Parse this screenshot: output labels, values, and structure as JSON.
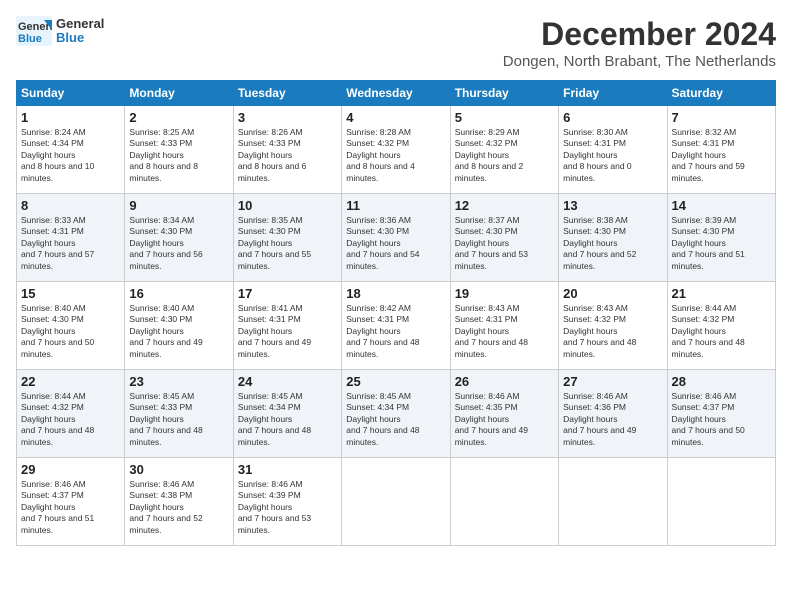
{
  "logo": {
    "line1": "General",
    "line2": "Blue"
  },
  "title": "December 2024",
  "location": "Dongen, North Brabant, The Netherlands",
  "weekdays": [
    "Sunday",
    "Monday",
    "Tuesday",
    "Wednesday",
    "Thursday",
    "Friday",
    "Saturday"
  ],
  "weeks": [
    [
      {
        "day": "1",
        "sunrise": "8:24 AM",
        "sunset": "4:34 PM",
        "daylight": "8 hours and 10 minutes."
      },
      {
        "day": "2",
        "sunrise": "8:25 AM",
        "sunset": "4:33 PM",
        "daylight": "8 hours and 8 minutes."
      },
      {
        "day": "3",
        "sunrise": "8:26 AM",
        "sunset": "4:33 PM",
        "daylight": "8 hours and 6 minutes."
      },
      {
        "day": "4",
        "sunrise": "8:28 AM",
        "sunset": "4:32 PM",
        "daylight": "8 hours and 4 minutes."
      },
      {
        "day": "5",
        "sunrise": "8:29 AM",
        "sunset": "4:32 PM",
        "daylight": "8 hours and 2 minutes."
      },
      {
        "day": "6",
        "sunrise": "8:30 AM",
        "sunset": "4:31 PM",
        "daylight": "8 hours and 0 minutes."
      },
      {
        "day": "7",
        "sunrise": "8:32 AM",
        "sunset": "4:31 PM",
        "daylight": "7 hours and 59 minutes."
      }
    ],
    [
      {
        "day": "8",
        "sunrise": "8:33 AM",
        "sunset": "4:31 PM",
        "daylight": "7 hours and 57 minutes."
      },
      {
        "day": "9",
        "sunrise": "8:34 AM",
        "sunset": "4:30 PM",
        "daylight": "7 hours and 56 minutes."
      },
      {
        "day": "10",
        "sunrise": "8:35 AM",
        "sunset": "4:30 PM",
        "daylight": "7 hours and 55 minutes."
      },
      {
        "day": "11",
        "sunrise": "8:36 AM",
        "sunset": "4:30 PM",
        "daylight": "7 hours and 54 minutes."
      },
      {
        "day": "12",
        "sunrise": "8:37 AM",
        "sunset": "4:30 PM",
        "daylight": "7 hours and 53 minutes."
      },
      {
        "day": "13",
        "sunrise": "8:38 AM",
        "sunset": "4:30 PM",
        "daylight": "7 hours and 52 minutes."
      },
      {
        "day": "14",
        "sunrise": "8:39 AM",
        "sunset": "4:30 PM",
        "daylight": "7 hours and 51 minutes."
      }
    ],
    [
      {
        "day": "15",
        "sunrise": "8:40 AM",
        "sunset": "4:30 PM",
        "daylight": "7 hours and 50 minutes."
      },
      {
        "day": "16",
        "sunrise": "8:40 AM",
        "sunset": "4:30 PM",
        "daylight": "7 hours and 49 minutes."
      },
      {
        "day": "17",
        "sunrise": "8:41 AM",
        "sunset": "4:31 PM",
        "daylight": "7 hours and 49 minutes."
      },
      {
        "day": "18",
        "sunrise": "8:42 AM",
        "sunset": "4:31 PM",
        "daylight": "7 hours and 48 minutes."
      },
      {
        "day": "19",
        "sunrise": "8:43 AM",
        "sunset": "4:31 PM",
        "daylight": "7 hours and 48 minutes."
      },
      {
        "day": "20",
        "sunrise": "8:43 AM",
        "sunset": "4:32 PM",
        "daylight": "7 hours and 48 minutes."
      },
      {
        "day": "21",
        "sunrise": "8:44 AM",
        "sunset": "4:32 PM",
        "daylight": "7 hours and 48 minutes."
      }
    ],
    [
      {
        "day": "22",
        "sunrise": "8:44 AM",
        "sunset": "4:32 PM",
        "daylight": "7 hours and 48 minutes."
      },
      {
        "day": "23",
        "sunrise": "8:45 AM",
        "sunset": "4:33 PM",
        "daylight": "7 hours and 48 minutes."
      },
      {
        "day": "24",
        "sunrise": "8:45 AM",
        "sunset": "4:34 PM",
        "daylight": "7 hours and 48 minutes."
      },
      {
        "day": "25",
        "sunrise": "8:45 AM",
        "sunset": "4:34 PM",
        "daylight": "7 hours and 48 minutes."
      },
      {
        "day": "26",
        "sunrise": "8:46 AM",
        "sunset": "4:35 PM",
        "daylight": "7 hours and 49 minutes."
      },
      {
        "day": "27",
        "sunrise": "8:46 AM",
        "sunset": "4:36 PM",
        "daylight": "7 hours and 49 minutes."
      },
      {
        "day": "28",
        "sunrise": "8:46 AM",
        "sunset": "4:37 PM",
        "daylight": "7 hours and 50 minutes."
      }
    ],
    [
      {
        "day": "29",
        "sunrise": "8:46 AM",
        "sunset": "4:37 PM",
        "daylight": "7 hours and 51 minutes."
      },
      {
        "day": "30",
        "sunrise": "8:46 AM",
        "sunset": "4:38 PM",
        "daylight": "7 hours and 52 minutes."
      },
      {
        "day": "31",
        "sunrise": "8:46 AM",
        "sunset": "4:39 PM",
        "daylight": "7 hours and 53 minutes."
      },
      null,
      null,
      null,
      null
    ]
  ]
}
